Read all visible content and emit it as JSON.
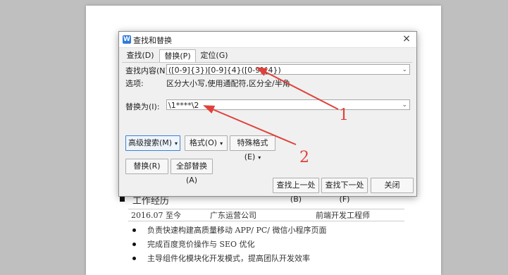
{
  "dialog": {
    "title": "查找和替换",
    "close": "×",
    "tabs": [
      "查找(D)",
      "替换(P)",
      "定位(G)"
    ],
    "find_label": "查找内容(N):",
    "find_value": "([0-9]{3})[0-9]{4}([0-9]{4})",
    "options_label": "选项:",
    "options_value": "区分大小写,使用通配符,区分全/半角",
    "replace_label": "替换为(I):",
    "replace_value": "\\1****\\2",
    "btn_advanced": "高级搜索(M)",
    "btn_format": "格式(O)",
    "btn_special": "特殊格式(E)",
    "btn_replace": "替换(R)",
    "btn_replace_all": "全部替换(A)",
    "btn_find_prev": "查找上一处(B)",
    "btn_find_next": "查找下一处(F)",
    "btn_close": "关闭"
  },
  "annotations": [
    "1",
    "2"
  ],
  "document": {
    "section_title": "工作经历",
    "table_row": [
      "2016.07 至今",
      "广东运营公司",
      "前端开发工程师"
    ],
    "bullets": [
      "负责快速构建高质量移动 APP/ PC/  微信小程序页面",
      "完成百度竞价操作与 SEO 优化",
      "主导组件化模块化开发模式，提高团队开发效率"
    ]
  },
  "colors": {
    "annotation_red": "#e0403a",
    "app_icon_blue": "#2f7bd9"
  }
}
